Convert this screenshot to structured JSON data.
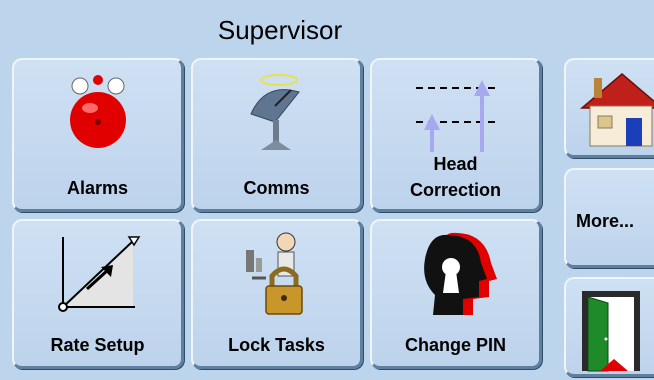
{
  "header": {
    "title": "Supervisor"
  },
  "tiles": {
    "alarms": {
      "label": "Alarms",
      "icon": "alarm-bell-icon"
    },
    "comms": {
      "label": "Comms",
      "icon": "satellite-dish-icon"
    },
    "head_correction": {
      "label_line1": "Head",
      "label_line2": "Correction",
      "icon": "head-correction-icon"
    },
    "rate_setup": {
      "label": "Rate Setup",
      "icon": "rate-graph-icon"
    },
    "lock_tasks": {
      "label": "Lock Tasks",
      "icon": "padlock-icon"
    },
    "change_pin": {
      "label": "Change PIN",
      "icon": "keyhole-head-icon"
    }
  },
  "sidebar": {
    "home": {
      "icon": "home-icon"
    },
    "more": {
      "label": "More..."
    },
    "exit": {
      "icon": "exit-door-icon"
    }
  },
  "colors": {
    "background": "#bcd4ec",
    "tile": "#c8dcf0",
    "accent_red": "#e00000",
    "arrow": "#a8a8f0"
  }
}
